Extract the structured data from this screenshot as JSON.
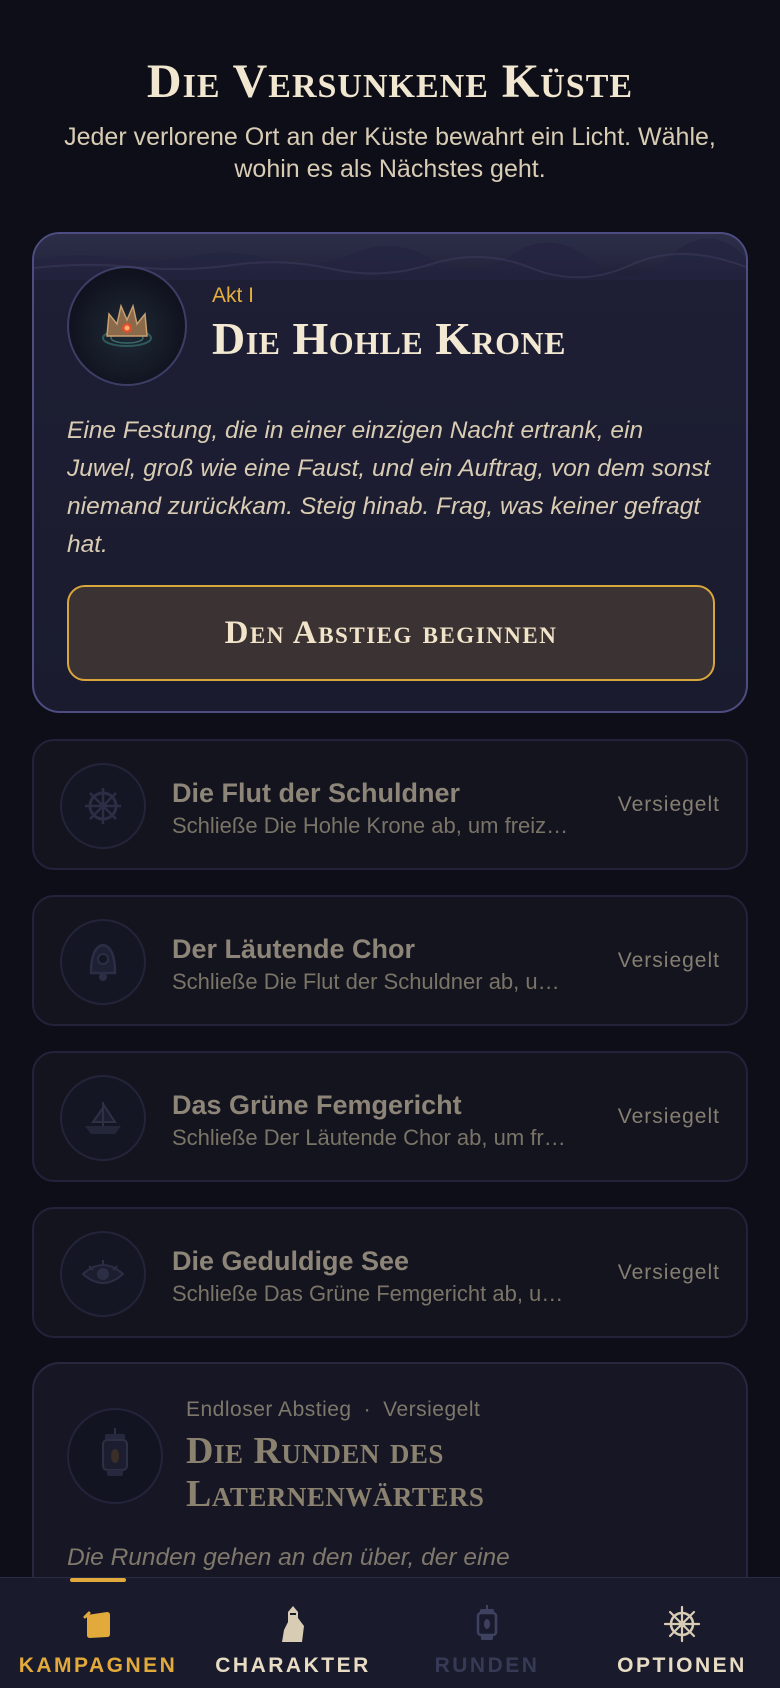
{
  "header": {
    "title": "Die Versunkene Küste",
    "subtitle": "Jeder verlorene Ort an der Küste bewahrt ein Licht. Wähle, wohin es als Nächstes geht."
  },
  "featured": {
    "act": "Akt I",
    "title": "Die Hohle Krone",
    "description": "Eine Festung, die in einer einzigen Nacht ertrank, ein Juwel, groß wie eine Faust, und ein Auftrag, von dem sonst niemand zurückkam. Steig hinab. Frag, was keiner gefragt hat.",
    "button_label": "Den Abstieg beginnen",
    "icon": "crown-icon"
  },
  "locked_campaigns": [
    {
      "title": "Die Flut der Schuldner",
      "hint": "Schließe Die Hohle Krone ab, um freiz…",
      "status": "Versiegelt",
      "icon": "ship-wheel-emblem-icon"
    },
    {
      "title": "Der Läutende Chor",
      "hint": "Schließe Die Flut der Schuldner ab, u…",
      "status": "Versiegelt",
      "icon": "bell-icon"
    },
    {
      "title": "Das Grüne Femgericht",
      "hint": "Schließe Der Läutende Chor ab, um fr…",
      "status": "Versiegelt",
      "icon": "ship-icon"
    },
    {
      "title": "Die Geduldige See",
      "hint": "Schließe Das Grüne Femgericht ab, u…",
      "status": "Versiegelt",
      "icon": "eye-icon"
    }
  ],
  "endless": {
    "mode": "Endloser Abstieg",
    "separator": "·",
    "status": "Versiegelt",
    "title": "Die Runden des Laternenwärters",
    "description": "Die Runden gehen an den über, der eine",
    "icon": "lantern-icon"
  },
  "bottom_nav": {
    "items": [
      {
        "label": "KAMPAGNEN",
        "icon": "cards-icon",
        "active": true
      },
      {
        "label": "CHARAKTER",
        "icon": "character-icon",
        "active": false
      },
      {
        "label": "RUNDEN",
        "icon": "lantern-icon",
        "active": false,
        "disabled": true
      },
      {
        "label": "OPTIONEN",
        "icon": "ship-wheel-icon",
        "active": false
      }
    ]
  },
  "colors": {
    "background": "#0e0e18",
    "accent_gold": "#e2a93b",
    "card_border": "#4d4d82",
    "text_cream": "#f1e6cf"
  }
}
